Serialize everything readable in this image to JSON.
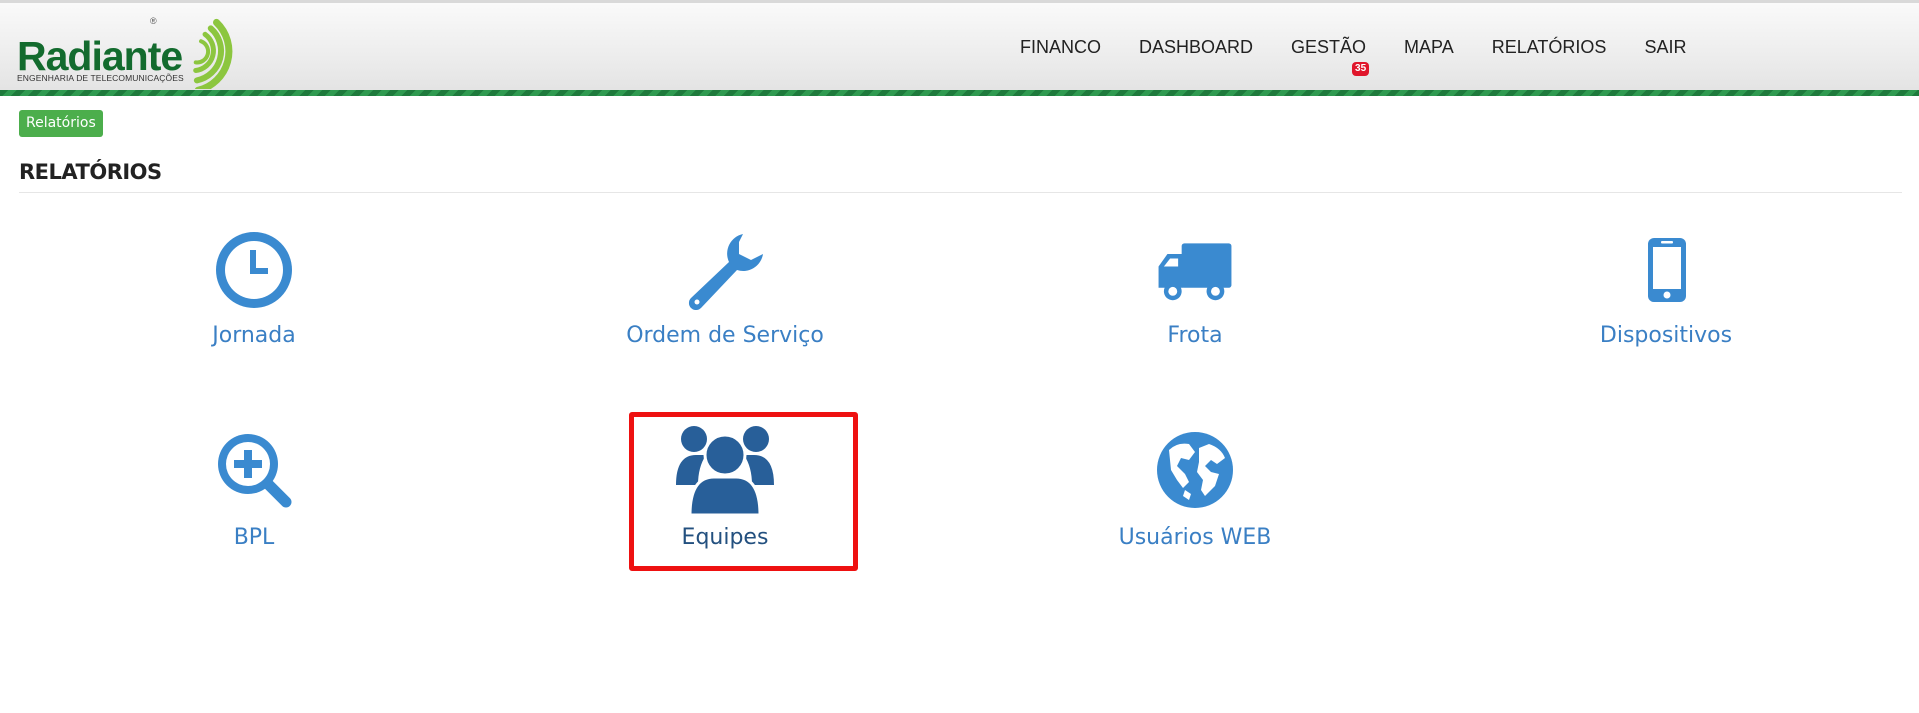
{
  "brand": {
    "name": "Radiante",
    "tagline": "ENGENHARIA DE TELECOMUNICAÇÕES",
    "registered_mark": "®",
    "color": "#136b2e"
  },
  "nav": {
    "items": [
      {
        "label": "FINANCO"
      },
      {
        "label": "DASHBOARD"
      },
      {
        "label": "GESTÃO",
        "badge": "35"
      },
      {
        "label": "MAPA"
      },
      {
        "label": "RELATÓRIOS"
      },
      {
        "label": "SAIR"
      }
    ]
  },
  "breadcrumb": {
    "label": "Relatórios",
    "color": "#4cae4c"
  },
  "page": {
    "title": "RELATÓRIOS"
  },
  "reports": {
    "accent_color": "#3a7fc4",
    "selected_color": "#23507f",
    "highlight_color": "#ee1111",
    "items": [
      {
        "label": "Jornada",
        "icon": "clock-icon"
      },
      {
        "label": "Ordem de Serviço",
        "icon": "wrench-icon"
      },
      {
        "label": "Frota",
        "icon": "truck-icon"
      },
      {
        "label": "Dispositivos",
        "icon": "mobile-phone-icon"
      },
      {
        "label": "BPL",
        "icon": "zoom-in-icon"
      },
      {
        "label": "Equipes",
        "icon": "users-group-icon",
        "selected": true
      },
      {
        "label": "Usuários WEB",
        "icon": "globe-icon"
      }
    ]
  }
}
